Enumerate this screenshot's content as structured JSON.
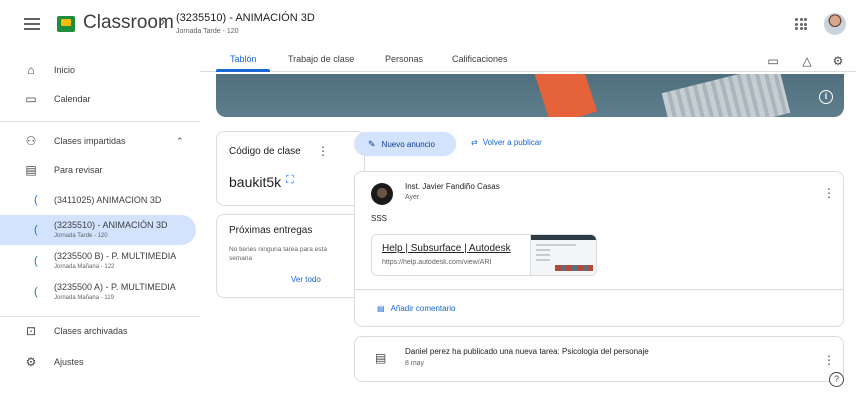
{
  "app": {
    "title": "Classroom"
  },
  "header": {
    "class_title": "(3235510) - ANIMACIÓN 3D",
    "class_subtitle": "Jornada Tarde - 120"
  },
  "sidebar": {
    "home": "Inicio",
    "calendar": "Calendar",
    "teaching": "Clases impartidas",
    "to_review": "Para revisar",
    "classes": [
      {
        "label": "(3411025) ANIMACION 3D",
        "sub": ""
      },
      {
        "label": "(3235510) - ANIMACIÓN 3D",
        "sub": "Jornada Tarde - 120"
      },
      {
        "label": "(3235500 B) - P. MULTIMEDIA",
        "sub": "Jornada Mañana - 122"
      },
      {
        "label": "(3235500 A) - P. MULTIMEDIA",
        "sub": "Jornada Mañana - 119"
      }
    ],
    "archived": "Clases archivadas",
    "settings": "Ajustes"
  },
  "tabs": [
    "Tablón",
    "Trabajo de clase",
    "Personas",
    "Calificaciones"
  ],
  "class_code": {
    "title": "Código de clase",
    "value": "baukit5k"
  },
  "upcoming": {
    "title": "Próximas entregas",
    "empty_text": "No tienes ninguna tarea para esta semana",
    "view_all": "Ver todo"
  },
  "actions": {
    "new_announcement": "Nuevo anuncio",
    "repost": "Volver a publicar"
  },
  "post": {
    "author": "Inst. Javier Fandiño Casas",
    "date": "Ayer",
    "body": "SSS",
    "link_title": "Help | Subsurface | Autodesk",
    "link_url": "https://help.autodesk.com/view/ARI",
    "comment": "Añadir comentario"
  },
  "task": {
    "title": "Daniel perez ha publicado una nueva tarea: Psicologia del personaje",
    "date": "8 may"
  },
  "colors": {
    "accent": "#1967d2",
    "selected_bg": "#d3e3fd",
    "banner": "#56727f"
  }
}
